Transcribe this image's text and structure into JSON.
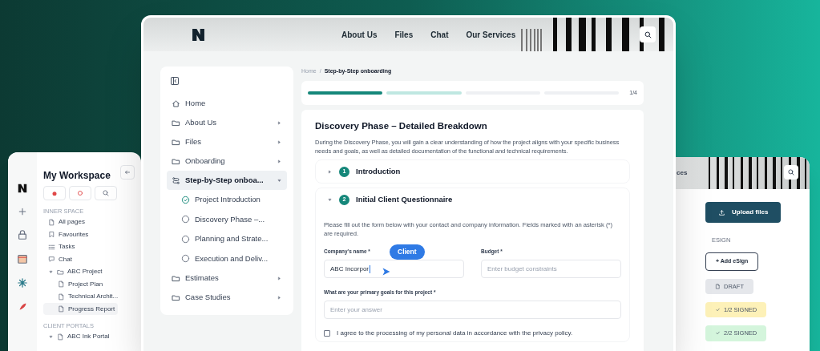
{
  "left_card": {
    "title": "My Workspace",
    "section_1": "INNER SPACE",
    "items": [
      {
        "kind": "page",
        "label": "All pages"
      },
      {
        "kind": "star",
        "label": "Favourites"
      },
      {
        "kind": "tasks",
        "label": "Tasks"
      },
      {
        "kind": "chat",
        "label": "Chat"
      },
      {
        "kind": "folder",
        "label": "ABC Project",
        "expanded": true,
        "children": [
          {
            "kind": "page",
            "label": "Project Plan",
            "selected": false
          },
          {
            "kind": "page",
            "label": "Technical Archit...",
            "selected": false
          },
          {
            "kind": "page",
            "label": "Progress Report",
            "selected": true
          }
        ]
      }
    ],
    "section_2": "CLIENT PORTALS",
    "portal": {
      "label": "ABC Ink Portal",
      "expanded": true
    }
  },
  "header": {
    "nav": [
      "About Us",
      "Files",
      "Chat",
      "Our Services"
    ]
  },
  "sidebar": {
    "items": [
      {
        "kind": "home",
        "label": "Home",
        "has_menu": false,
        "selected": false
      },
      {
        "kind": "folder",
        "label": "About Us",
        "has_menu": true,
        "selected": false
      },
      {
        "kind": "folder",
        "label": "Files",
        "has_menu": true,
        "selected": false
      },
      {
        "kind": "folder",
        "label": "Onboarding",
        "has_menu": true,
        "selected": false
      },
      {
        "kind": "steps",
        "label": "Step-by-Step onboa...",
        "has_menu": true,
        "selected": true,
        "children": [
          {
            "label": "Project Introduction",
            "done": true
          },
          {
            "label": "Discovery Phase –...",
            "done": false
          },
          {
            "label": "Planning and Strate...",
            "done": false
          },
          {
            "label": "Execution and Deliv...",
            "done": false
          }
        ]
      },
      {
        "kind": "folder",
        "label": "Estimates",
        "has_menu": true,
        "selected": false
      },
      {
        "kind": "folder",
        "label": "Case Studies",
        "has_menu": true,
        "selected": false
      }
    ]
  },
  "breadcrumb": {
    "items": [
      "Home",
      "Step-by-Step onboarding"
    ],
    "separator": "/"
  },
  "progress": {
    "segments": [
      {
        "kind": "done"
      },
      {
        "kind": "current"
      },
      {
        "kind": "todo"
      },
      {
        "kind": "todo"
      }
    ],
    "counter": "1/4"
  },
  "content": {
    "title": "Discovery Phase – Detailed Breakdown",
    "intro": "During the Discovery Phase, you will gain a clear understanding of how the project aligns with your specific business needs and goals, as well as detailed documentation of the functional and technical requirements.",
    "sections": [
      {
        "number": "1",
        "title": "Introduction",
        "expanded": false
      },
      {
        "number": "2",
        "title": "Initial Client Questionnaire",
        "expanded": true
      }
    ],
    "form_note": "Please fill out the form below with your contact and company information. Fields marked with an asterisk (*) are required.",
    "fields": [
      {
        "label": "Company's name *",
        "value": "ABC Incorpor",
        "cursor_tag": "Client"
      },
      {
        "label": "Budget *",
        "placeholder": "Enter budget constraints"
      }
    ],
    "goals": {
      "label": "What are your primary goals for this project *",
      "placeholder": "Enter your answer"
    },
    "consent": {
      "label": "I agree to the processing of my personal data in accordance with the privacy policy.",
      "checked": false
    }
  },
  "right_card": {
    "header_text": "ces",
    "upload": "Upload files",
    "column": "ESIGN",
    "add": "+ Add eSign",
    "statuses": [
      {
        "kind": "draft",
        "label": "DRAFT",
        "color": "#e5e7eb"
      },
      {
        "kind": "partial",
        "label": "1/2 SIGNED",
        "color": "#fdf1b8"
      },
      {
        "kind": "signed",
        "label": "2/2 SIGNED",
        "color": "#d4f5dc"
      }
    ]
  }
}
